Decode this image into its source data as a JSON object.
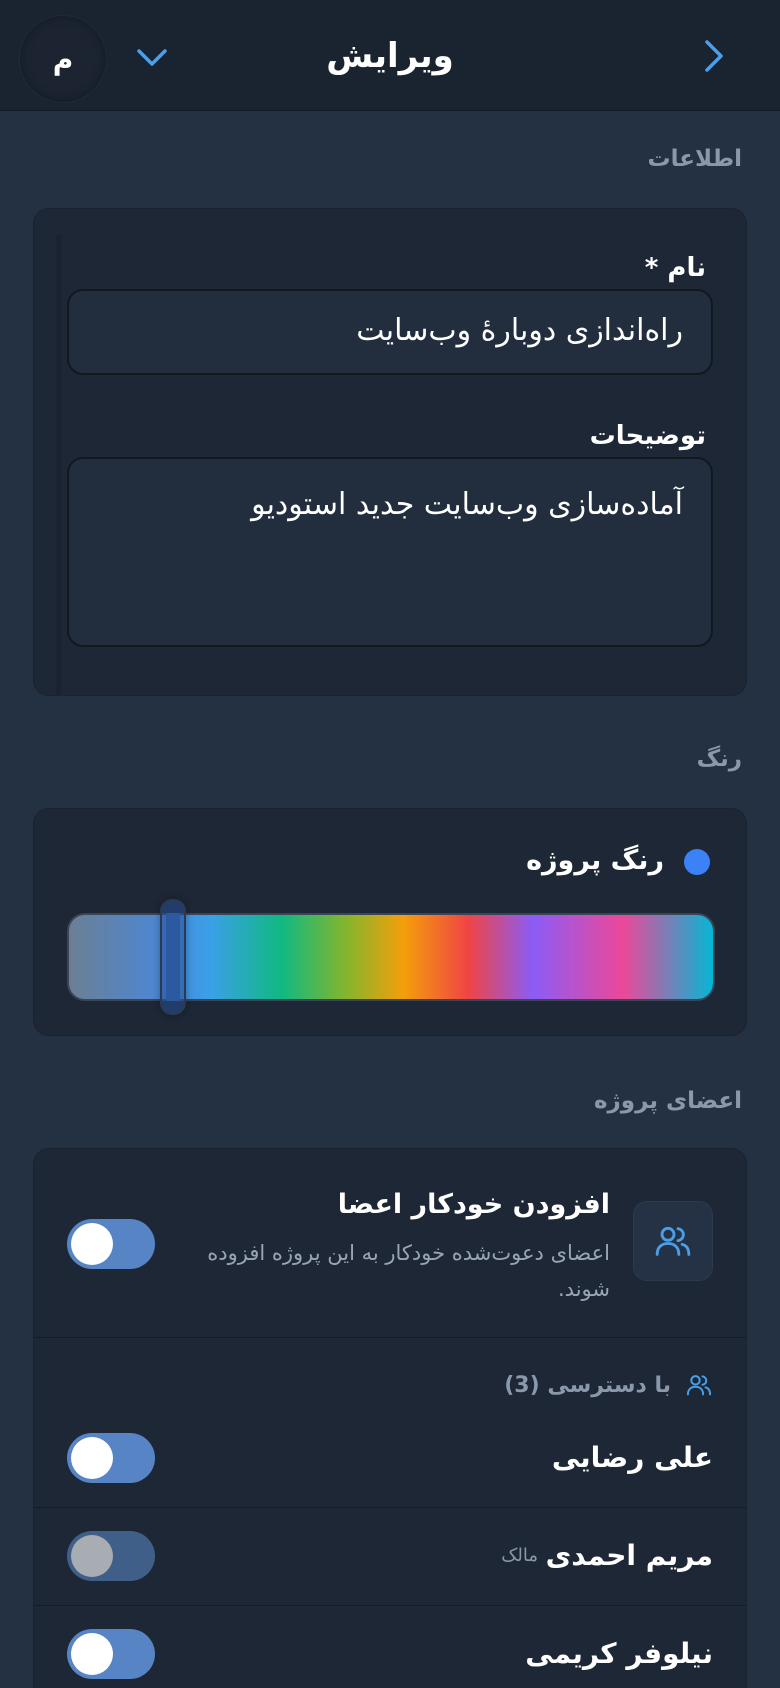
{
  "header": {
    "title": "ویرایش",
    "avatar_letter": "م",
    "back_icon": "chevron-right-icon",
    "menu_icon": "chevron-down-icon"
  },
  "info_section": {
    "label": "اطلاعات",
    "name_label": "نام *",
    "name_value": "راه‌اندازی دوبارهٔ وب‌سایت",
    "description_label": "توضیحات",
    "description_value": "آماده‌سازی وب‌سایت جدید استودیو"
  },
  "color_section": {
    "label": "رنگ",
    "color_label": "رنگ پروژه",
    "selected_color": "#3b82f6",
    "hue_position": 0.14
  },
  "members_section": {
    "label": "اعضای پروژه",
    "auto_add": {
      "title": "افزودن خودکار اعضا",
      "description": "اعضای دعوت‌شده خودکار به این پروژه افزوده شوند.",
      "enabled": true
    },
    "access_label": "با دسترسی (3)",
    "members": [
      {
        "name": "علی رضایی",
        "badge": "",
        "enabled": true
      },
      {
        "name": "مریم احمدی",
        "badge": "مالک",
        "enabled": false
      },
      {
        "name": "نیلوفر کریمی",
        "badge": "",
        "enabled": true
      }
    ]
  },
  "colors": {
    "background": "#243142",
    "card": "#1d2735",
    "accent": "#5684c4",
    "link": "#4a9fe8"
  }
}
